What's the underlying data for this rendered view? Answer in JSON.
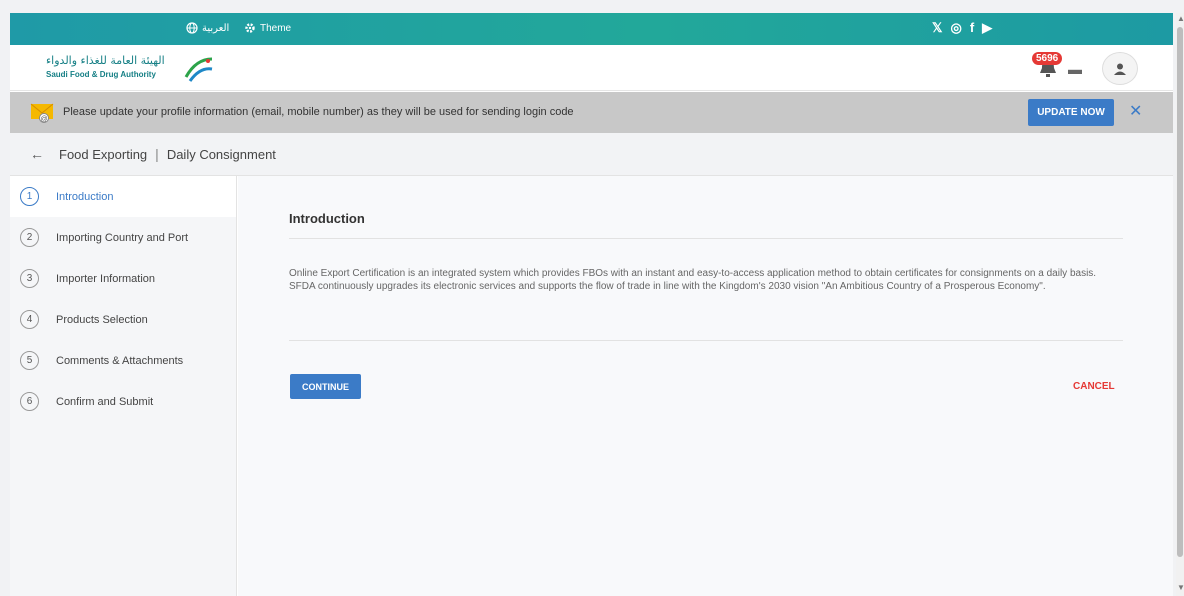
{
  "topbar": {
    "lang_label": "العربية",
    "theme_label": "Theme",
    "social": [
      "twitter-icon",
      "instagram-icon",
      "facebook-icon",
      "youtube-icon"
    ]
  },
  "header": {
    "logo_ar": "الهيئة العامة للغذاء والدواء",
    "logo_en": "Saudi Food & Drug Authority",
    "notification_count": "5696"
  },
  "banner": {
    "message": "Please update your profile information (email, mobile number) as they will be used for sending login code",
    "update_label": "UPDATE NOW",
    "close_label": "✕"
  },
  "breadcrumb": {
    "back": "←",
    "item1": "Food Exporting",
    "separator": "|",
    "item2": "Daily Consignment"
  },
  "steps": [
    {
      "num": "1",
      "label": "Introduction"
    },
    {
      "num": "2",
      "label": "Importing Country and Port"
    },
    {
      "num": "3",
      "label": "Importer Information"
    },
    {
      "num": "4",
      "label": "Products Selection"
    },
    {
      "num": "5",
      "label": "Comments & Attachments"
    },
    {
      "num": "6",
      "label": "Confirm and Submit"
    }
  ],
  "content": {
    "title": "Introduction",
    "body": "Online Export Certification is an integrated system which provides FBOs with an instant and easy-to-access application method to obtain certificates for consignments on a daily basis. SFDA continuously upgrades its electronic services and supports the flow of trade in line with the Kingdom's 2030 vision \"An Ambitious Country of a Prosperous Economy\".",
    "continue_label": "CONTINUE",
    "cancel_label": "CANCEL"
  },
  "colors": {
    "accent": "#3b7bc7",
    "topbar": "#22a89a",
    "cancel": "#e53935"
  }
}
